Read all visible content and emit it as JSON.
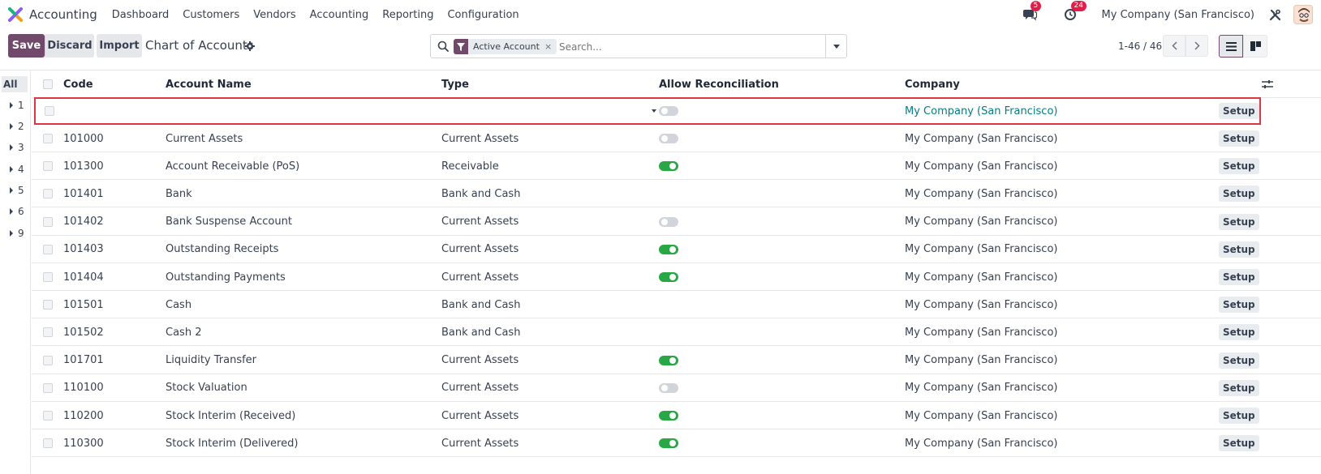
{
  "app": {
    "title": "Accounting",
    "menu": [
      "Dashboard",
      "Customers",
      "Vendors",
      "Accounting",
      "Reporting",
      "Configuration"
    ]
  },
  "systray": {
    "messages_count": "5",
    "activities_count": "24",
    "company": "My Company (San Francisco)"
  },
  "control": {
    "save_label": "Save",
    "discard_label": "Discard",
    "import_label": "Import",
    "page_title": "Chart of Accounts",
    "facet_label": "Active Account",
    "facet_close": "×",
    "search_placeholder": "Search...",
    "pager": "1-46 / 46"
  },
  "left_panel": {
    "all_label": "All",
    "groups": [
      "1",
      "2",
      "3",
      "4",
      "5",
      "6",
      "9"
    ]
  },
  "table": {
    "headers": {
      "code": "Code",
      "name": "Account Name",
      "type": "Type",
      "reconcile": "Allow Reconciliation",
      "company": "Company"
    },
    "editing_row": {
      "company": "My Company (San Francisco)",
      "setup": "Setup"
    },
    "rows": [
      {
        "code": "101000",
        "name": "Current Assets",
        "type": "Current Assets",
        "reconcile": "off",
        "company": "My Company (San Francisco)",
        "setup": "Setup"
      },
      {
        "code": "101300",
        "name": "Account Receivable (PoS)",
        "type": "Receivable",
        "reconcile": "on",
        "company": "My Company (San Francisco)",
        "setup": "Setup"
      },
      {
        "code": "101401",
        "name": "Bank",
        "type": "Bank and Cash",
        "reconcile": "none",
        "company": "My Company (San Francisco)",
        "setup": "Setup"
      },
      {
        "code": "101402",
        "name": "Bank Suspense Account",
        "type": "Current Assets",
        "reconcile": "off",
        "company": "My Company (San Francisco)",
        "setup": "Setup"
      },
      {
        "code": "101403",
        "name": "Outstanding Receipts",
        "type": "Current Assets",
        "reconcile": "on",
        "company": "My Company (San Francisco)",
        "setup": "Setup"
      },
      {
        "code": "101404",
        "name": "Outstanding Payments",
        "type": "Current Assets",
        "reconcile": "on",
        "company": "My Company (San Francisco)",
        "setup": "Setup"
      },
      {
        "code": "101501",
        "name": "Cash",
        "type": "Bank and Cash",
        "reconcile": "none",
        "company": "My Company (San Francisco)",
        "setup": "Setup"
      },
      {
        "code": "101502",
        "name": "Cash 2",
        "type": "Bank and Cash",
        "reconcile": "none",
        "company": "My Company (San Francisco)",
        "setup": "Setup"
      },
      {
        "code": "101701",
        "name": "Liquidity Transfer",
        "type": "Current Assets",
        "reconcile": "on",
        "company": "My Company (San Francisco)",
        "setup": "Setup"
      },
      {
        "code": "110100",
        "name": "Stock Valuation",
        "type": "Current Assets",
        "reconcile": "off",
        "company": "My Company (San Francisco)",
        "setup": "Setup"
      },
      {
        "code": "110200",
        "name": "Stock Interim (Received)",
        "type": "Current Assets",
        "reconcile": "on",
        "company": "My Company (San Francisco)",
        "setup": "Setup"
      },
      {
        "code": "110300",
        "name": "Stock Interim (Delivered)",
        "type": "Current Assets",
        "reconcile": "on",
        "company": "My Company (San Francisco)",
        "setup": "Setup"
      }
    ]
  },
  "colors": {
    "brand": "#71496b",
    "toggle_on": "#28a745",
    "toggle_off": "#d1d5db",
    "highlight_border": "#dc3545",
    "link": "#017e84",
    "badge": "#e11d48"
  }
}
